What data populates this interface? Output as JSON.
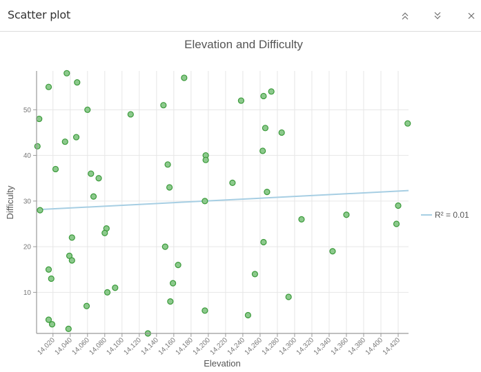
{
  "panel": {
    "title": "Scatter plot",
    "buttons": [
      {
        "name": "collapse-up",
        "icon": "double-chevron-up-icon"
      },
      {
        "name": "collapse-down",
        "icon": "double-chevron-down-icon"
      },
      {
        "name": "close",
        "icon": "close-icon"
      }
    ]
  },
  "colors": {
    "point_fill": "#8cc98c",
    "point_stroke": "#3a9a3a",
    "trend_line": "#a6cee3",
    "grid": "#e6e6e6",
    "axis": "#999999"
  },
  "chart_data": {
    "type": "scatter",
    "title": "Elevation and Difficulty",
    "xlabel": "Elevation",
    "ylabel": "Difficulty",
    "xlim": [
      14001,
      14432
    ],
    "ylim": [
      1,
      58.5
    ],
    "grid": true,
    "x_ticks": [
      14020,
      14040,
      14060,
      14080,
      14100,
      14120,
      14140,
      14160,
      14180,
      14200,
      14220,
      14240,
      14260,
      14280,
      14300,
      14320,
      14340,
      14360,
      14380,
      14400,
      14420
    ],
    "x_tick_labels": [
      "14,020",
      "14,040",
      "14,060",
      "14,080",
      "14,100",
      "14,120",
      "14,140",
      "14,160",
      "14,180",
      "14,200",
      "14,220",
      "14,240",
      "14,260",
      "14,280",
      "14,300",
      "14,320",
      "14,340",
      "14,360",
      "14,380",
      "14,400",
      "14,420"
    ],
    "y_ticks": [
      10,
      20,
      30,
      40,
      50
    ],
    "y_tick_labels": [
      "10",
      "20",
      "30",
      "40",
      "50"
    ],
    "points": [
      {
        "x": 14036,
        "y": 58
      },
      {
        "x": 14048,
        "y": 56
      },
      {
        "x": 14015,
        "y": 55
      },
      {
        "x": 14060,
        "y": 50
      },
      {
        "x": 14110,
        "y": 49
      },
      {
        "x": 14004,
        "y": 48
      },
      {
        "x": 14047,
        "y": 44
      },
      {
        "x": 14034,
        "y": 43
      },
      {
        "x": 14002,
        "y": 42
      },
      {
        "x": 14023,
        "y": 37
      },
      {
        "x": 14064,
        "y": 36
      },
      {
        "x": 14073,
        "y": 35
      },
      {
        "x": 14067,
        "y": 31
      },
      {
        "x": 14005,
        "y": 28
      },
      {
        "x": 14082,
        "y": 24
      },
      {
        "x": 14080,
        "y": 23
      },
      {
        "x": 14042,
        "y": 22
      },
      {
        "x": 14039,
        "y": 18
      },
      {
        "x": 14042,
        "y": 17
      },
      {
        "x": 14015,
        "y": 15
      },
      {
        "x": 14018,
        "y": 13
      },
      {
        "x": 14092,
        "y": 11
      },
      {
        "x": 14083,
        "y": 10
      },
      {
        "x": 14059,
        "y": 7
      },
      {
        "x": 14015,
        "y": 4
      },
      {
        "x": 14019,
        "y": 3
      },
      {
        "x": 14038,
        "y": 2
      },
      {
        "x": 14172,
        "y": 57
      },
      {
        "x": 14148,
        "y": 51
      },
      {
        "x": 14238,
        "y": 52
      },
      {
        "x": 14264,
        "y": 53
      },
      {
        "x": 14273,
        "y": 54
      },
      {
        "x": 14266,
        "y": 46
      },
      {
        "x": 14285,
        "y": 45
      },
      {
        "x": 14263,
        "y": 41
      },
      {
        "x": 14197,
        "y": 40
      },
      {
        "x": 14197,
        "y": 39
      },
      {
        "x": 14153,
        "y": 38
      },
      {
        "x": 14228,
        "y": 34
      },
      {
        "x": 14155,
        "y": 33
      },
      {
        "x": 14268,
        "y": 32
      },
      {
        "x": 14196,
        "y": 30
      },
      {
        "x": 14264,
        "y": 21
      },
      {
        "x": 14150,
        "y": 20
      },
      {
        "x": 14165,
        "y": 16
      },
      {
        "x": 14254,
        "y": 14
      },
      {
        "x": 14159,
        "y": 12
      },
      {
        "x": 14156,
        "y": 8
      },
      {
        "x": 14293,
        "y": 9
      },
      {
        "x": 14196,
        "y": 6
      },
      {
        "x": 14246,
        "y": 5
      },
      {
        "x": 14130,
        "y": 1
      },
      {
        "x": 14431,
        "y": 47
      },
      {
        "x": 14420,
        "y": 29
      },
      {
        "x": 14308,
        "y": 26
      },
      {
        "x": 14360,
        "y": 27
      },
      {
        "x": 14418,
        "y": 25
      },
      {
        "x": 14344,
        "y": 19
      }
    ],
    "trendline": {
      "x": [
        14001,
        14432
      ],
      "y": [
        28.1,
        32.3
      ]
    },
    "legend": {
      "entries": [
        "R² = 0.01"
      ],
      "placement": "right"
    }
  }
}
